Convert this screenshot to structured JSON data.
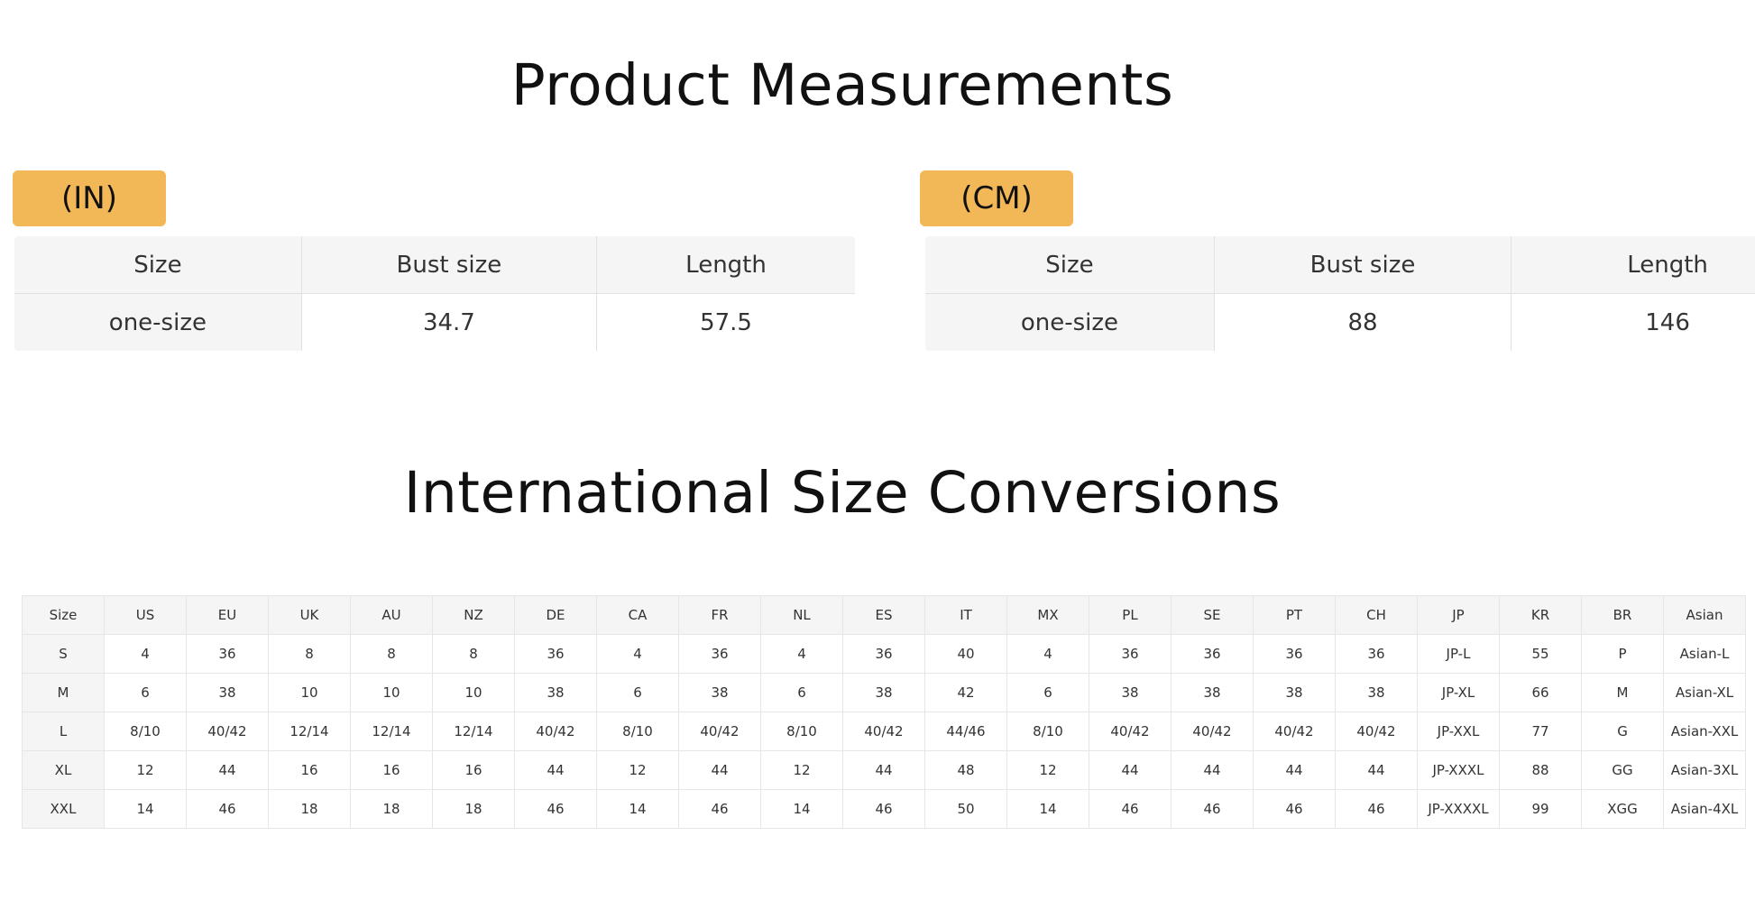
{
  "product_title": "Product Measurements",
  "intl_title": "International Size Conversions",
  "tables": {
    "in": {
      "badge": "(IN)",
      "headers": [
        "Size",
        "Bust size",
        "Length"
      ],
      "row": [
        "one-size",
        "34.7",
        "57.5"
      ]
    },
    "cm": {
      "badge": "(CM)",
      "headers": [
        "Size",
        "Bust size",
        "Length"
      ],
      "row": [
        "one-size",
        "88",
        "146"
      ]
    }
  },
  "conversion": {
    "headers": [
      "Size",
      "US",
      "EU",
      "UK",
      "AU",
      "NZ",
      "DE",
      "CA",
      "FR",
      "NL",
      "ES",
      "IT",
      "MX",
      "PL",
      "SE",
      "PT",
      "CH",
      "JP",
      "KR",
      "BR",
      "Asian"
    ],
    "rows": [
      [
        "S",
        "4",
        "36",
        "8",
        "8",
        "8",
        "36",
        "4",
        "36",
        "4",
        "36",
        "40",
        "4",
        "36",
        "36",
        "36",
        "36",
        "JP-L",
        "55",
        "P",
        "Asian-L"
      ],
      [
        "M",
        "6",
        "38",
        "10",
        "10",
        "10",
        "38",
        "6",
        "38",
        "6",
        "38",
        "42",
        "6",
        "38",
        "38",
        "38",
        "38",
        "JP-XL",
        "66",
        "M",
        "Asian-XL"
      ],
      [
        "L",
        "8/10",
        "40/42",
        "12/14",
        "12/14",
        "12/14",
        "40/42",
        "8/10",
        "40/42",
        "8/10",
        "40/42",
        "44/46",
        "8/10",
        "40/42",
        "40/42",
        "40/42",
        "40/42",
        "JP-XXL",
        "77",
        "G",
        "Asian-XXL"
      ],
      [
        "XL",
        "12",
        "44",
        "16",
        "16",
        "16",
        "44",
        "12",
        "44",
        "12",
        "44",
        "48",
        "12",
        "44",
        "44",
        "44",
        "44",
        "JP-XXXL",
        "88",
        "GG",
        "Asian-3XL"
      ],
      [
        "XXL",
        "14",
        "46",
        "18",
        "18",
        "18",
        "46",
        "14",
        "46",
        "14",
        "46",
        "50",
        "14",
        "46",
        "46",
        "46",
        "46",
        "JP-XXXXL",
        "99",
        "XGG",
        "Asian-4XL"
      ]
    ]
  },
  "colors": {
    "badge": "#f2b756",
    "header_bg": "#f5f5f5",
    "border": "#e1e1e1"
  }
}
